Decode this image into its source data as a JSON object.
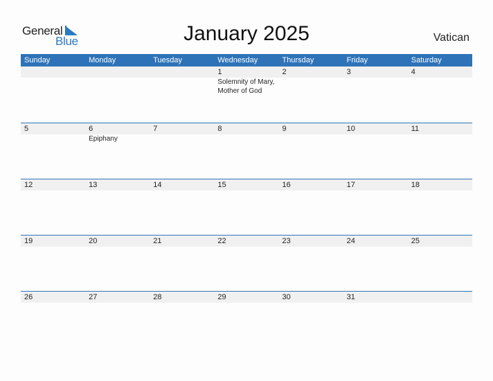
{
  "logo": {
    "word1": "General",
    "word2": "Blue"
  },
  "title": "January 2025",
  "country": "Vatican",
  "weekdays": [
    "Sunday",
    "Monday",
    "Tuesday",
    "Wednesday",
    "Thursday",
    "Friday",
    "Saturday"
  ],
  "weeks": [
    {
      "days": [
        "",
        "",
        "",
        "1",
        "2",
        "3",
        "4"
      ],
      "holidays": [
        "",
        "",
        "",
        "Solemnity of Mary, Mother of God",
        "",
        "",
        ""
      ]
    },
    {
      "days": [
        "5",
        "6",
        "7",
        "8",
        "9",
        "10",
        "11"
      ],
      "holidays": [
        "",
        "Epiphany",
        "",
        "",
        "",
        "",
        ""
      ]
    },
    {
      "days": [
        "12",
        "13",
        "14",
        "15",
        "16",
        "17",
        "18"
      ],
      "holidays": [
        "",
        "",
        "",
        "",
        "",
        "",
        ""
      ]
    },
    {
      "days": [
        "19",
        "20",
        "21",
        "22",
        "23",
        "24",
        "25"
      ],
      "holidays": [
        "",
        "",
        "",
        "",
        "",
        "",
        ""
      ]
    },
    {
      "days": [
        "26",
        "27",
        "28",
        "29",
        "30",
        "31",
        ""
      ],
      "holidays": [
        "",
        "",
        "",
        "",
        "",
        "",
        ""
      ]
    }
  ],
  "colors": {
    "accent": "#2e73b8",
    "band": "#f0f0f0",
    "logo_blue": "#2a7ac0"
  }
}
